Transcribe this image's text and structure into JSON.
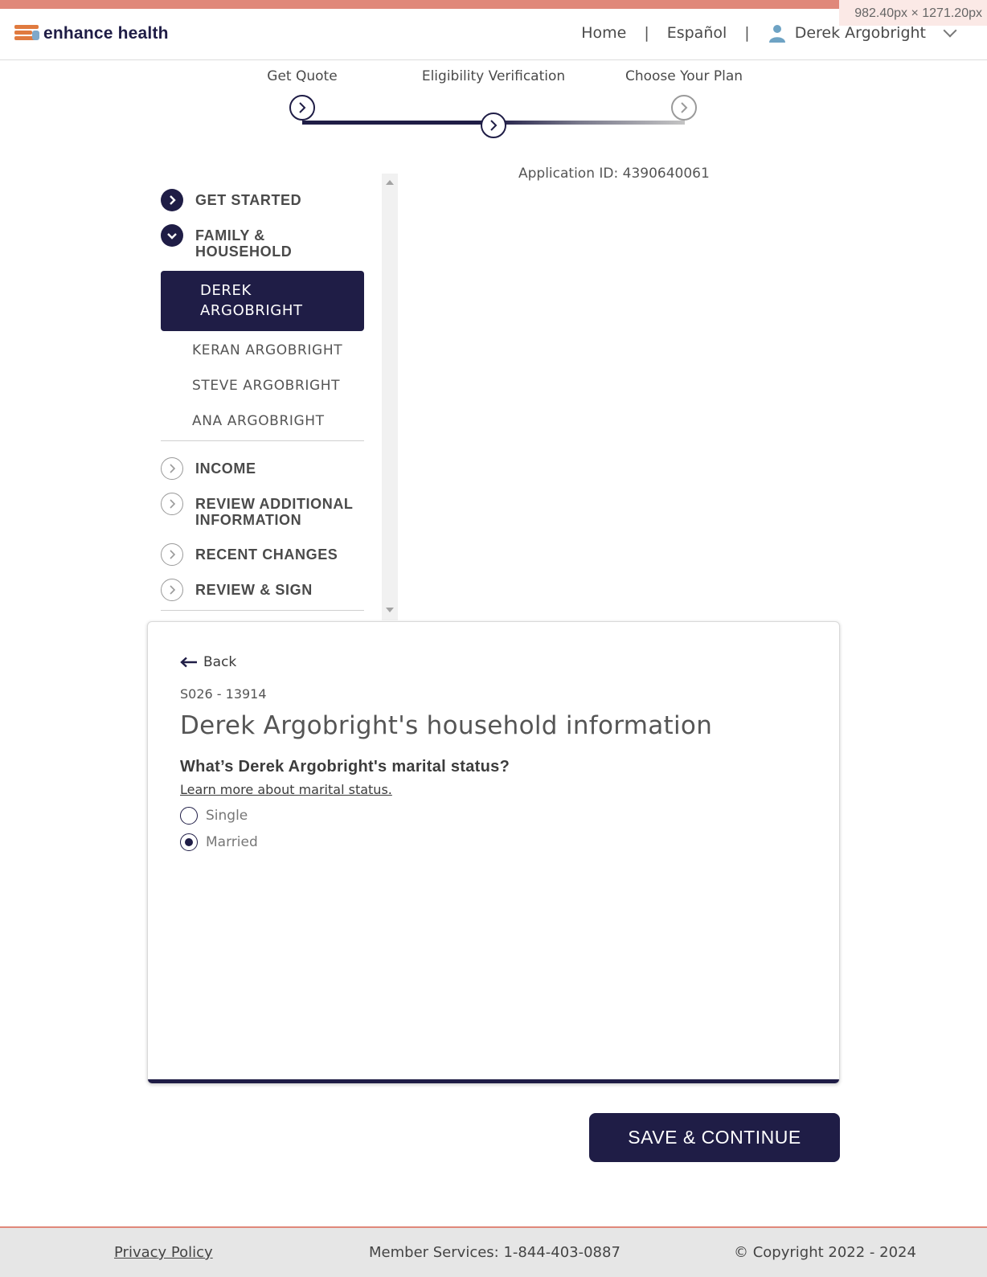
{
  "viewport_label": "982.40px × 1271.20px",
  "brand": {
    "name": "enhance health",
    "accent": "#e0887a",
    "navy": "#1f1d46"
  },
  "nav": {
    "home": "Home",
    "separator": "|",
    "language": "Español",
    "user_name": "Derek Argobright"
  },
  "stepper": {
    "steps": [
      {
        "label": "Get Quote",
        "state": "complete"
      },
      {
        "label": "Eligibility Verification",
        "state": "current"
      },
      {
        "label": "Choose Your Plan",
        "state": "upcoming"
      }
    ]
  },
  "application_id": "Application ID: 4390640061",
  "sidebar": {
    "sections": [
      {
        "label": "GET STARTED",
        "icon": "chevron-right-icon",
        "state": "complete"
      },
      {
        "label": "FAMILY & HOUSEHOLD",
        "icon": "chevron-down-icon",
        "state": "expanded"
      },
      {
        "label": "INCOME",
        "icon": "chevron-right-icon",
        "state": "upcoming"
      },
      {
        "label": "REVIEW ADDITIONAL INFORMATION",
        "icon": "chevron-right-icon",
        "state": "upcoming"
      },
      {
        "label": "RECENT CHANGES",
        "icon": "chevron-right-icon",
        "state": "upcoming"
      },
      {
        "label": "REVIEW & SIGN",
        "icon": "chevron-right-icon",
        "state": "upcoming"
      }
    ],
    "members": [
      {
        "name": "DEREK ARGOBRIGHT",
        "active": true
      },
      {
        "name": "KERAN ARGOBRIGHT",
        "active": false
      },
      {
        "name": "STEVE ARGOBRIGHT",
        "active": false
      },
      {
        "name": "ANA ARGOBRIGHT",
        "active": false
      }
    ]
  },
  "form": {
    "back_label": "Back",
    "screen_code": "S026 - 13914",
    "heading": "Derek Argobright's household information",
    "question": "What’s Derek Argobright's marital status?",
    "learn_more": "Learn more about marital status.",
    "options": [
      {
        "label": "Single",
        "checked": false
      },
      {
        "label": "Married",
        "checked": true
      }
    ],
    "save_label": "SAVE & CONTINUE"
  },
  "footer": {
    "privacy": "Privacy Policy",
    "member_services": "Member Services: 1-844-403-0887",
    "copyright": "© Copyright 2022 - 2024"
  }
}
